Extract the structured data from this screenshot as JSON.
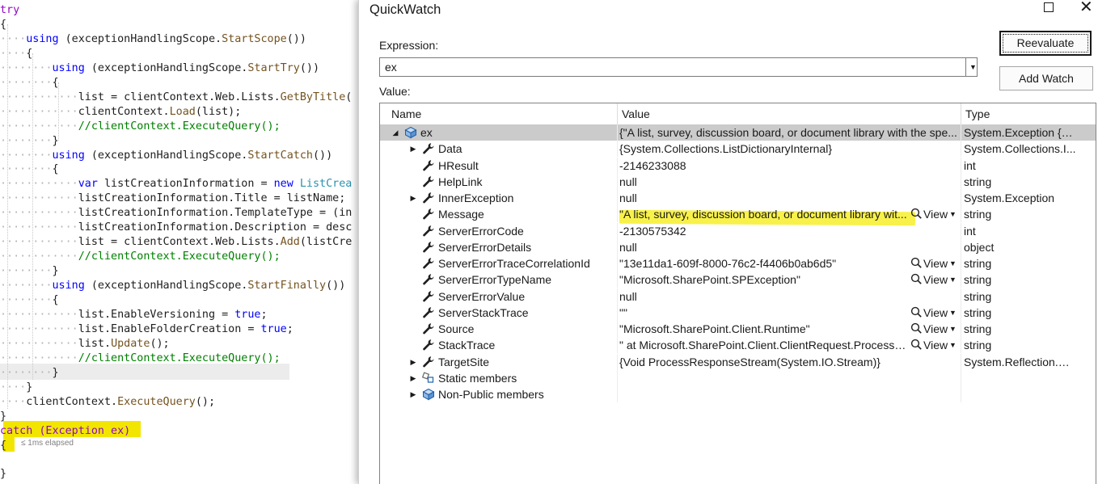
{
  "editor": {
    "lines": [
      {
        "indent": "",
        "tokens": [
          {
            "t": "try",
            "c": "ctrl"
          }
        ]
      },
      {
        "indent": "",
        "tokens": [
          {
            "t": "{",
            "c": "pl"
          }
        ]
      },
      {
        "indent": "····",
        "tokens": [
          {
            "t": "using",
            "c": "kw"
          },
          {
            "t": " (exceptionHandlingScope.",
            "c": "pl"
          },
          {
            "t": "StartScope",
            "c": "fn"
          },
          {
            "t": "())",
            "c": "pl"
          }
        ]
      },
      {
        "indent": "····",
        "tokens": [
          {
            "t": "{",
            "c": "pl"
          }
        ]
      },
      {
        "indent": "········",
        "tokens": [
          {
            "t": "using",
            "c": "kw"
          },
          {
            "t": " (exceptionHandlingScope.",
            "c": "pl"
          },
          {
            "t": "StartTry",
            "c": "fn"
          },
          {
            "t": "())",
            "c": "pl"
          }
        ]
      },
      {
        "indent": "········",
        "tokens": [
          {
            "t": "{",
            "c": "pl"
          }
        ]
      },
      {
        "indent": "············",
        "tokens": [
          {
            "t": "list = clientContext.Web.Lists.",
            "c": "pl"
          },
          {
            "t": "GetByTitle",
            "c": "fn"
          },
          {
            "t": "(",
            "c": "pl"
          }
        ]
      },
      {
        "indent": "············",
        "tokens": [
          {
            "t": "clientContext.",
            "c": "pl"
          },
          {
            "t": "Load",
            "c": "fn"
          },
          {
            "t": "(list);",
            "c": "pl"
          }
        ]
      },
      {
        "indent": "············",
        "tokens": [
          {
            "t": "//clientContext.ExecuteQuery();",
            "c": "cm"
          }
        ]
      },
      {
        "indent": "········",
        "tokens": [
          {
            "t": "}",
            "c": "pl"
          }
        ]
      },
      {
        "indent": "········",
        "tokens": [
          {
            "t": "using",
            "c": "kw"
          },
          {
            "t": " (exceptionHandlingScope.",
            "c": "pl"
          },
          {
            "t": "StartCatch",
            "c": "fn"
          },
          {
            "t": "())",
            "c": "pl"
          }
        ]
      },
      {
        "indent": "········",
        "tokens": [
          {
            "t": "{",
            "c": "pl"
          }
        ]
      },
      {
        "indent": "············",
        "tokens": [
          {
            "t": "var",
            "c": "kw"
          },
          {
            "t": " listCreationInformation = ",
            "c": "pl"
          },
          {
            "t": "new",
            "c": "kw"
          },
          {
            "t": " ",
            "c": "pl"
          },
          {
            "t": "ListCrea",
            "c": "ty"
          }
        ]
      },
      {
        "indent": "············",
        "tokens": [
          {
            "t": "listCreationInformation.Title = listName;",
            "c": "pl"
          }
        ]
      },
      {
        "indent": "············",
        "tokens": [
          {
            "t": "listCreationInformation.TemplateType = (in",
            "c": "pl"
          }
        ]
      },
      {
        "indent": "············",
        "tokens": [
          {
            "t": "listCreationInformation.Description = desc",
            "c": "pl"
          }
        ]
      },
      {
        "indent": "············",
        "tokens": [
          {
            "t": "list = clientContext.Web.Lists.",
            "c": "pl"
          },
          {
            "t": "Add",
            "c": "fn"
          },
          {
            "t": "(listCre",
            "c": "pl"
          }
        ]
      },
      {
        "indent": "············",
        "tokens": [
          {
            "t": "//clientContext.ExecuteQuery();",
            "c": "cm"
          }
        ]
      },
      {
        "indent": "········",
        "tokens": [
          {
            "t": "}",
            "c": "pl"
          }
        ]
      },
      {
        "indent": "········",
        "tokens": [
          {
            "t": "using",
            "c": "kw"
          },
          {
            "t": " (exceptionHandlingScope.",
            "c": "pl"
          },
          {
            "t": "StartFinally",
            "c": "fn"
          },
          {
            "t": "())",
            "c": "pl"
          }
        ]
      },
      {
        "indent": "········",
        "tokens": [
          {
            "t": "{",
            "c": "pl"
          }
        ]
      },
      {
        "indent": "············",
        "tokens": [
          {
            "t": "list.EnableVersioning = ",
            "c": "pl"
          },
          {
            "t": "true",
            "c": "kw"
          },
          {
            "t": ";",
            "c": "pl"
          }
        ]
      },
      {
        "indent": "············",
        "tokens": [
          {
            "t": "list.EnableFolderCreation = ",
            "c": "pl"
          },
          {
            "t": "true",
            "c": "kw"
          },
          {
            "t": ";",
            "c": "pl"
          }
        ]
      },
      {
        "indent": "············",
        "tokens": [
          {
            "t": "list.",
            "c": "pl"
          },
          {
            "t": "Update",
            "c": "fn"
          },
          {
            "t": "();",
            "c": "pl"
          }
        ]
      },
      {
        "indent": "············",
        "tokens": [
          {
            "t": "//clientContext.ExecuteQuery();",
            "c": "cm"
          }
        ]
      },
      {
        "indent": "········",
        "tokens": [
          {
            "t": "}",
            "c": "pl"
          }
        ]
      },
      {
        "indent": "····",
        "tokens": [
          {
            "t": "}",
            "c": "pl"
          }
        ]
      },
      {
        "indent": "····",
        "tokens": [
          {
            "t": "clientContext.",
            "c": "pl"
          },
          {
            "t": "ExecuteQuery",
            "c": "fn"
          },
          {
            "t": "();",
            "c": "pl"
          }
        ]
      },
      {
        "indent": "",
        "tokens": [
          {
            "t": "}",
            "c": "pl"
          }
        ]
      },
      {
        "indent": "",
        "tokens": [
          {
            "t": "catch (Exception ex)",
            "c": "ctrl"
          }
        ]
      },
      {
        "indent": "",
        "tokens": [
          {
            "t": "{",
            "c": "pl"
          }
        ]
      },
      {
        "indent": "",
        "tokens": []
      },
      {
        "indent": "",
        "tokens": [
          {
            "t": "}",
            "c": "pl"
          }
        ]
      }
    ],
    "elapsed": "≤ 1ms elapsed"
  },
  "quickwatch": {
    "title": "QuickWatch",
    "expression_label": "Expression:",
    "expression_value": "ex",
    "value_label": "Value:",
    "reevaluate_label": "Reevaluate",
    "add_watch_label": "Add Watch",
    "columns": {
      "name": "Name",
      "value": "Value",
      "type": "Type"
    },
    "view_label": "View",
    "rows": [
      {
        "name": "ex",
        "value": "{\"A list, survey, discussion board, or document library with the spe...",
        "type": "System.Exception {M...",
        "level": 0,
        "expander": "open",
        "icon": "object-icon",
        "view": false,
        "selected": true
      },
      {
        "name": "Data",
        "value": "{System.Collections.ListDictionaryInternal}",
        "type": "System.Collections.I...",
        "level": 1,
        "expander": "closed",
        "icon": "wrench-icon",
        "view": false
      },
      {
        "name": "HResult",
        "value": "-2146233088",
        "type": "int",
        "level": 1,
        "expander": "none",
        "icon": "wrench-icon",
        "view": false
      },
      {
        "name": "HelpLink",
        "value": "null",
        "type": "string",
        "level": 1,
        "expander": "none",
        "icon": "wrench-icon",
        "view": false
      },
      {
        "name": "InnerException",
        "value": "null",
        "type": "System.Exception",
        "level": 1,
        "expander": "closed",
        "icon": "wrench-icon",
        "view": false
      },
      {
        "name": "Message",
        "value": "\"A list, survey, discussion board, or document library wit...",
        "type": "string",
        "level": 1,
        "expander": "none",
        "icon": "wrench-icon",
        "view": true
      },
      {
        "name": "ServerErrorCode",
        "value": "-2130575342",
        "type": "int",
        "level": 1,
        "expander": "none",
        "icon": "wrench-icon",
        "view": false
      },
      {
        "name": "ServerErrorDetails",
        "value": "null",
        "type": "object",
        "level": 1,
        "expander": "none",
        "icon": "wrench-icon",
        "view": false
      },
      {
        "name": "ServerErrorTraceCorrelationId",
        "value": "\"13e11da1-609f-8000-76c2-f4406b0ab6d5\"",
        "type": "string",
        "level": 1,
        "expander": "none",
        "icon": "wrench-icon",
        "view": true
      },
      {
        "name": "ServerErrorTypeName",
        "value": "\"Microsoft.SharePoint.SPException\"",
        "type": "string",
        "level": 1,
        "expander": "none",
        "icon": "wrench-icon",
        "view": true
      },
      {
        "name": "ServerErrorValue",
        "value": "null",
        "type": "string",
        "level": 1,
        "expander": "none",
        "icon": "wrench-icon",
        "view": false
      },
      {
        "name": "ServerStackTrace",
        "value": "\"\"",
        "type": "string",
        "level": 1,
        "expander": "none",
        "icon": "wrench-icon",
        "view": true
      },
      {
        "name": "Source",
        "value": "\"Microsoft.SharePoint.Client.Runtime\"",
        "type": "string",
        "level": 1,
        "expander": "none",
        "icon": "wrench-icon",
        "view": true
      },
      {
        "name": "StackTrace",
        "value": "\"   at Microsoft.SharePoint.Client.ClientRequest.ProcessR...",
        "type": "string",
        "level": 1,
        "expander": "none",
        "icon": "wrench-icon",
        "view": true
      },
      {
        "name": "TargetSite",
        "value": "{Void ProcessResponseStream(System.IO.Stream)}",
        "type": "System.Reflection.M...",
        "level": 1,
        "expander": "closed",
        "icon": "wrench-icon",
        "view": false
      },
      {
        "name": "Static members",
        "value": "",
        "type": "",
        "level": 1,
        "expander": "closed",
        "icon": "static-members-icon",
        "view": false
      },
      {
        "name": "Non-Public members",
        "value": "",
        "type": "",
        "level": 1,
        "expander": "closed",
        "icon": "object-icon",
        "view": false
      }
    ]
  }
}
